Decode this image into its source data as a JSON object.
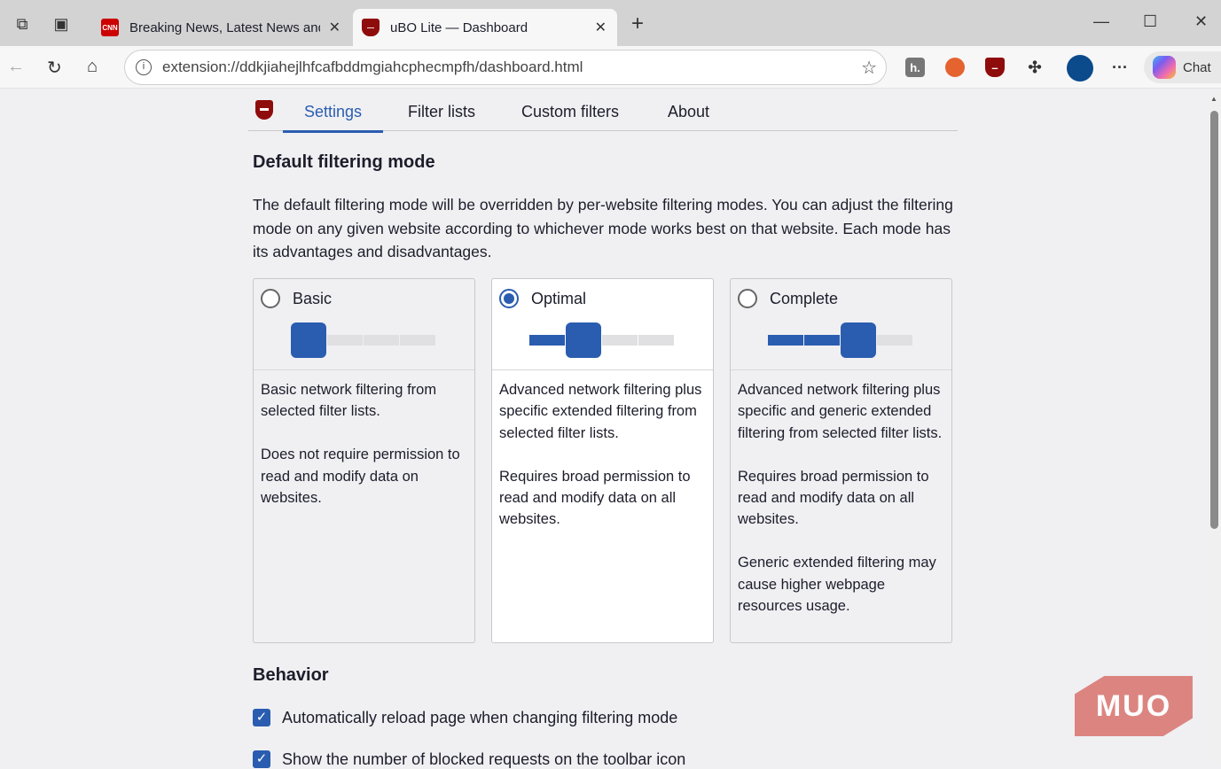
{
  "browser": {
    "tabs": [
      {
        "title": "Breaking News, Latest News and Videos",
        "favicon": "CNN",
        "active": false
      },
      {
        "title": "uBO Lite — Dashboard",
        "active": true
      }
    ],
    "url": "extension://ddkjiahejlhfcafbddmgiahcphecmpfh/dashboard.html",
    "chat_label": "Chat",
    "ext_h": "h."
  },
  "nav": {
    "tabs": [
      "Settings",
      "Filter lists",
      "Custom filters",
      "About"
    ],
    "active": "Settings"
  },
  "filtering": {
    "heading": "Default filtering mode",
    "intro": "The default filtering mode will be overridden by per-website filtering modes. You can adjust the filtering mode on any given website according to whichever mode works best on that website. Each mode has its advantages and disadvantages.",
    "modes": [
      {
        "name": "Basic",
        "selected": false,
        "level": 1,
        "desc": [
          "Basic network filtering from selected filter lists.",
          "Does not require permission to read and modify data on websites."
        ]
      },
      {
        "name": "Optimal",
        "selected": true,
        "level": 2,
        "desc": [
          "Advanced network filtering plus specific extended filtering from selected filter lists.",
          "Requires broad permission to read and modify data on all websites."
        ]
      },
      {
        "name": "Complete",
        "selected": false,
        "level": 3,
        "desc": [
          "Advanced network filtering plus specific and generic extended filtering from selected filter lists.",
          "Requires broad permission to read and modify data on all websites.",
          "Generic extended filtering may cause higher webpage resources usage."
        ]
      }
    ]
  },
  "behavior": {
    "heading": "Behavior",
    "options": [
      {
        "label": "Automatically reload page when changing filtering mode",
        "checked": true
      },
      {
        "label": "Show the number of blocked requests on the toolbar icon",
        "checked": true
      }
    ]
  },
  "watermark": "MUO",
  "colors": {
    "accent": "#2a5db0",
    "ubo": "#8f0c0c"
  }
}
